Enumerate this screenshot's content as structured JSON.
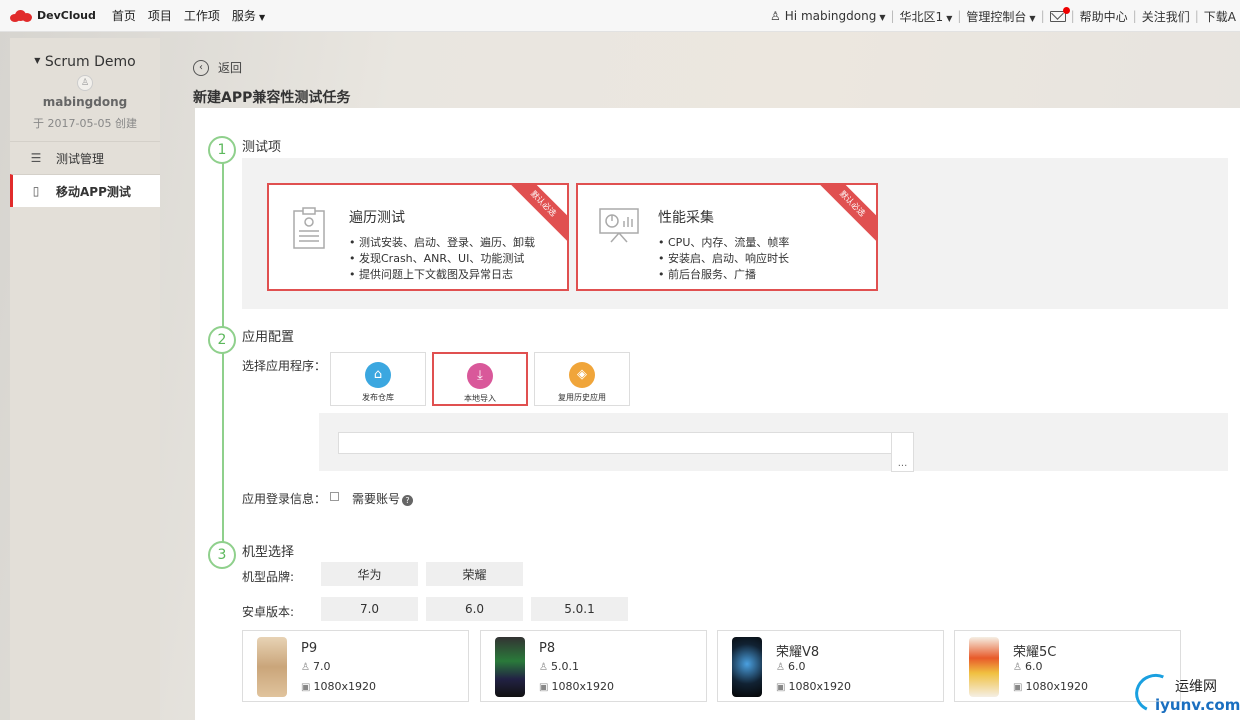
{
  "topbar": {
    "brand": "DevCloud",
    "nav": [
      "首页",
      "项目",
      "工作项",
      "服务"
    ],
    "user": "Hi mabingdong",
    "region": "华北区1",
    "console": "管理控制台",
    "help": "帮助中心",
    "follow": "关注我们",
    "download": "下载A"
  },
  "sidebar": {
    "project_name": "Scrum Demo",
    "user": "mabingdong",
    "created": "于 2017-05-05 创建",
    "items": [
      {
        "label": "测试管理",
        "icon": "list-icon"
      },
      {
        "label": "移动APP测试",
        "icon": "phone-icon"
      }
    ]
  },
  "page": {
    "back": "返回",
    "title": "新建APP兼容性测试任务"
  },
  "sections": {
    "s1": {
      "num": "1",
      "title": "测试项"
    },
    "s2": {
      "num": "2",
      "title": "应用配置"
    },
    "s3": {
      "num": "3",
      "title": "机型选择"
    }
  },
  "cards": [
    {
      "title": "遍历测试",
      "ribbon": "默认必选",
      "items": [
        "测试安装、启动、登录、遍历、卸载",
        "发现Crash、ANR、UI、功能测试",
        "提供问题上下文截图及异常日志"
      ]
    },
    {
      "title": "性能采集",
      "ribbon": "默认必选",
      "items": [
        "CPU、内存、流量、帧率",
        "安装启、启动、响应时长",
        "前后台服务、广播"
      ]
    }
  ],
  "app_config": {
    "select_label": "选择应用程序：",
    "sources": [
      "发布仓库",
      "本地导入",
      "复用历史应用"
    ],
    "browse": "...",
    "login_label": "应用登录信息：",
    "need_account": "需要账号",
    "help_mark": "?"
  },
  "model_select": {
    "brand_label": "机型品牌:",
    "brands": [
      "华为",
      "荣耀"
    ],
    "version_label": "安卓版本:",
    "versions": [
      "7.0",
      "6.0",
      "5.0.1"
    ],
    "devices": [
      {
        "name": "P9",
        "version": "7.0",
        "resolution": "1080x1920"
      },
      {
        "name": "P8",
        "version": "5.0.1",
        "resolution": "1080x1920"
      },
      {
        "name": "荣耀V8",
        "version": "6.0",
        "resolution": "1080x1920"
      },
      {
        "name": "荣耀5C",
        "version": "6.0",
        "resolution": "1080x1920"
      }
    ]
  },
  "watermark": {
    "cn": "运维网",
    "en": "iyunv.com"
  },
  "colors": {
    "accent": "#e05050",
    "step": "#8fd08c",
    "brand": "#e12b2b"
  }
}
